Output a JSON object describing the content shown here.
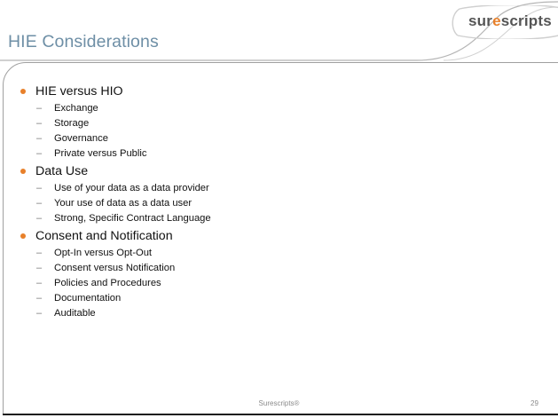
{
  "slide": {
    "title": "HIE Considerations",
    "logo": {
      "prefix": "sur",
      "accent": "e",
      "suffix": "scripts",
      "mark": "®",
      "brand_gray": "#555555",
      "brand_orange": "#e8802a"
    },
    "title_color": "#6e8fa6",
    "bullet_color": "#e8802a",
    "sections": [
      {
        "heading": "HIE versus HIO",
        "items": [
          "Exchange",
          "Storage",
          "Governance",
          "Private versus Public"
        ]
      },
      {
        "heading": "Data Use",
        "items": [
          "Use of your data as a data provider",
          "Your use of data as a data user",
          "Strong, Specific Contract Language"
        ]
      },
      {
        "heading": "Consent and Notification",
        "items": [
          "Opt-In versus Opt-Out",
          "Consent versus Notification",
          "Policies and Procedures",
          "Documentation",
          "Auditable"
        ]
      }
    ],
    "sub_marker": "–",
    "footer": {
      "brand": "Surescripts®",
      "page_number": "29"
    }
  }
}
